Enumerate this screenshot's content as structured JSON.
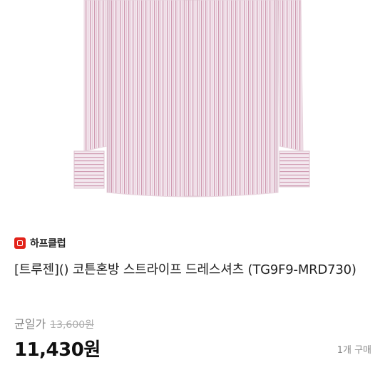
{
  "product": {
    "image_alt_name": "striped-dress-shirt-photo",
    "store_name": "하프클럽",
    "title": "[트루젠]() 코튼혼방 스트라이프 드레스셔츠 (TG9F9-MRD730)",
    "price_label": "균일가",
    "original_price": "13,600원",
    "current_price": "11,430원",
    "purchase_count": "1개 구매"
  },
  "colors": {
    "shirt_base": "#efe3ec",
    "stripe": "#c58aa4",
    "brand": "#e2231a"
  }
}
